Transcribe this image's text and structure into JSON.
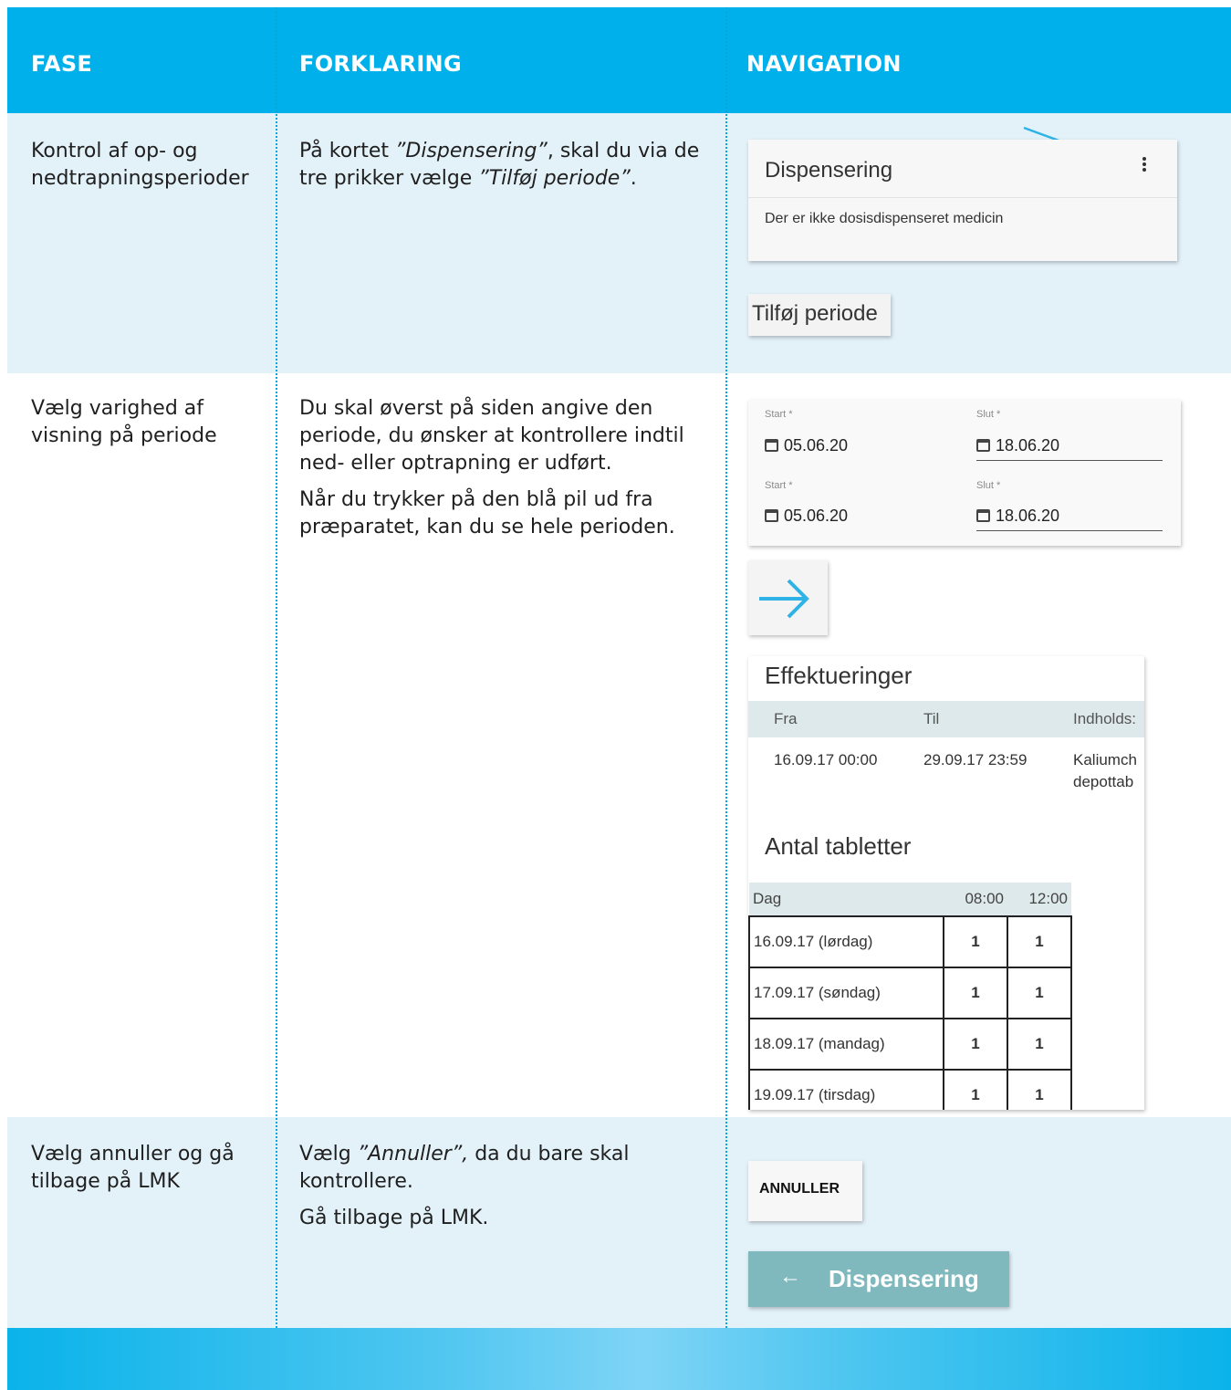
{
  "header": {
    "col1": "FASE",
    "col2": "FORKLARING",
    "col3": "NAVIGATION"
  },
  "rows": [
    {
      "fase": "Kontrol af op- og nedtrapningsperioder",
      "forklaring_parts": [
        "På kortet ",
        "”Dispensering”",
        ", skal du via de tre prikker vælge ",
        "”Tilføj periode”",
        "."
      ]
    },
    {
      "fase": "Vælg varighed af visning på periode",
      "forklaring_p1": "Du skal øverst på siden angive den periode, du ønsker at kontrollere indtil ned- eller optrapning er udført.",
      "forklaring_p2": "Når du trykker på den blå pil ud fra præparatet, kan du se hele perioden."
    },
    {
      "fase": "Vælg annuller og gå tilbage på LMK",
      "forklaring_parts": [
        "Vælg ",
        "”Annuller”,",
        " da du bare skal kontrollere."
      ],
      "forklaring_p2": "Gå tilbage på LMK."
    }
  ],
  "dispensering_card": {
    "title": "Dispensering",
    "message": "Der er ikke dosisdispenseret medicin",
    "menu_icon": "more-vert-icon"
  },
  "tilfoj_button": "Tilføj periode",
  "date_card": {
    "start_label": "Start *",
    "slut_label": "Slut *",
    "rows": [
      {
        "start": "05.06.20",
        "slut": "18.06.20"
      },
      {
        "start": "05.06.20",
        "slut": "18.06.20"
      }
    ]
  },
  "effektueringer": {
    "title": "Effektueringer",
    "headers": [
      "Fra",
      "Til",
      "Indholds:"
    ],
    "row": {
      "fra": "16.09.17 00:00",
      "til": "29.09.17 23:59",
      "indhold_l1": "Kaliumch",
      "indhold_l2": "depottab"
    }
  },
  "antal": {
    "title": "Antal tabletter",
    "headers": [
      "Dag",
      "08:00",
      "12:00"
    ],
    "rows": [
      {
        "dag": "16.09.17 (lørdag)",
        "a": "1",
        "b": "1"
      },
      {
        "dag": "17.09.17 (søndag)",
        "a": "1",
        "b": "1"
      },
      {
        "dag": "18.09.17 (mandag)",
        "a": "1",
        "b": "1"
      },
      {
        "dag": "19.09.17 (tirsdag)",
        "a": "1",
        "b": "1"
      }
    ]
  },
  "annuller_button": "ANNULLER",
  "back_button": {
    "arrow": "←",
    "label": "Dispensering"
  },
  "colors": {
    "header": "#00b0ea",
    "row_tint": "#e3f1f9",
    "accent_arrow": "#2fb3e6",
    "back_button": "#7fb9be"
  }
}
